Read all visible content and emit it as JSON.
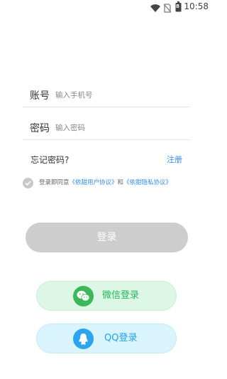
{
  "status_bar": {
    "time": "10:58",
    "icons": [
      "wifi-icon",
      "no-sim-icon",
      "battery-icon"
    ],
    "battery_level": "8"
  },
  "form": {
    "account_label": "账号",
    "account_placeholder": "输入手机号",
    "password_label": "密码",
    "password_placeholder": "输入密码"
  },
  "forgot_password": "忘记密码?",
  "register": "注册",
  "agreement": {
    "prefix": "登录即同意",
    "user_agreement": "《依甜用户协议》",
    "conjunction": "和",
    "privacy_agreement": "《依甜隐私协议》"
  },
  "buttons": {
    "login": "登录",
    "wechat_login": "微信登录",
    "qq_login": "QQ登录"
  },
  "colors": {
    "link": "#2f8dee",
    "wechat": "#3cb85a",
    "qq": "#2ba6ee",
    "login_disabled": "#cdcdcd"
  }
}
